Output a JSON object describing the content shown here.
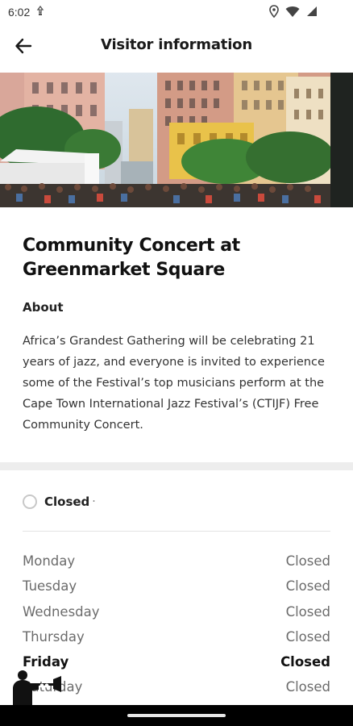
{
  "status_bar": {
    "time": "6:02",
    "left_icon": "notification-icon",
    "icons": [
      "location-icon",
      "wifi-icon",
      "cell-signal-icon"
    ]
  },
  "app_bar": {
    "title": "Visitor information",
    "back_icon": "arrow-left-icon"
  },
  "hero": {
    "description_icon": "photo-greenmarket-square"
  },
  "event": {
    "title": "Community Concert at Greenmarket Square",
    "about_heading": "About",
    "about_text": "Africa’s Grandest Gathering will be celebrating 21 years of jazz, and everyone is invited to experience some of the Festival’s top musicians perform at the Cape Town International Jazz Festival’s (CTIJF) Free Community Concert."
  },
  "hours": {
    "status": "Closed",
    "status_suffix": "·",
    "days": [
      {
        "day": "Monday",
        "value": "Closed",
        "today": false
      },
      {
        "day": "Tuesday",
        "value": "Closed",
        "today": false
      },
      {
        "day": "Wednesday",
        "value": "Closed",
        "today": false
      },
      {
        "day": "Thursday",
        "value": "Closed",
        "today": false
      },
      {
        "day": "Friday",
        "value": "Closed",
        "today": true
      },
      {
        "day": "Saturday",
        "value": "Closed",
        "today": false
      }
    ]
  },
  "colors": {
    "background": "#ffffff",
    "divider": "#ededed",
    "text_primary": "#111111",
    "text_secondary": "#6b6b6b",
    "nav_bar": "#000000"
  }
}
